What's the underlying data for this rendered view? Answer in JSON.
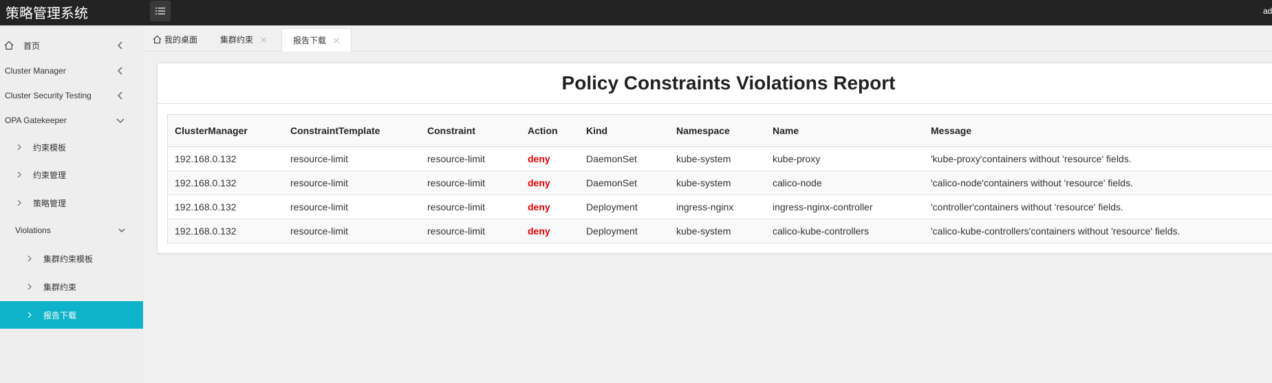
{
  "header": {
    "app_title": "策略管理系统",
    "menu_toggle_icon": "list-icon",
    "user_abbr": "ad"
  },
  "sidebar": {
    "items": [
      {
        "label": "首页",
        "icon": "home-icon"
      },
      {
        "label": "Cluster Manager"
      },
      {
        "label": "Cluster Security Testing"
      },
      {
        "label": "OPA Gatekeeper"
      },
      {
        "label": "约束模板"
      },
      {
        "label": "约束管理"
      },
      {
        "label": "策略管理"
      },
      {
        "label": "Violations"
      },
      {
        "label": "集群约束模板"
      },
      {
        "label": "集群约束"
      },
      {
        "label": "报告下载"
      }
    ],
    "active_color": "#0cb3c9"
  },
  "tabs": [
    {
      "label": "我的桌面",
      "icon": "home-icon"
    },
    {
      "label": "集群约束"
    },
    {
      "label": "报告下载",
      "active": true
    }
  ],
  "report": {
    "title": "Policy Constraints Violations Report",
    "columns": [
      "ClusterManager",
      "ConstraintTemplate",
      "Constraint",
      "Action",
      "Kind",
      "Namespace",
      "Name",
      "Message"
    ],
    "rows": [
      [
        "192.168.0.132",
        "resource-limit",
        "resource-limit",
        "deny",
        "DaemonSet",
        "kube-system",
        "kube-proxy",
        "'kube-proxy'containers without 'resource' fields."
      ],
      [
        "192.168.0.132",
        "resource-limit",
        "resource-limit",
        "deny",
        "DaemonSet",
        "kube-system",
        "calico-node",
        "'calico-node'containers without 'resource' fields."
      ],
      [
        "192.168.0.132",
        "resource-limit",
        "resource-limit",
        "deny",
        "Deployment",
        "ingress-nginx",
        "ingress-nginx-controller",
        "'controller'containers without 'resource' fields."
      ],
      [
        "192.168.0.132",
        "resource-limit",
        "resource-limit",
        "deny",
        "Deployment",
        "kube-system",
        "calico-kube-controllers",
        "'calico-kube-controllers'containers without 'resource' fields."
      ]
    ],
    "deny_color": "#e60000"
  }
}
